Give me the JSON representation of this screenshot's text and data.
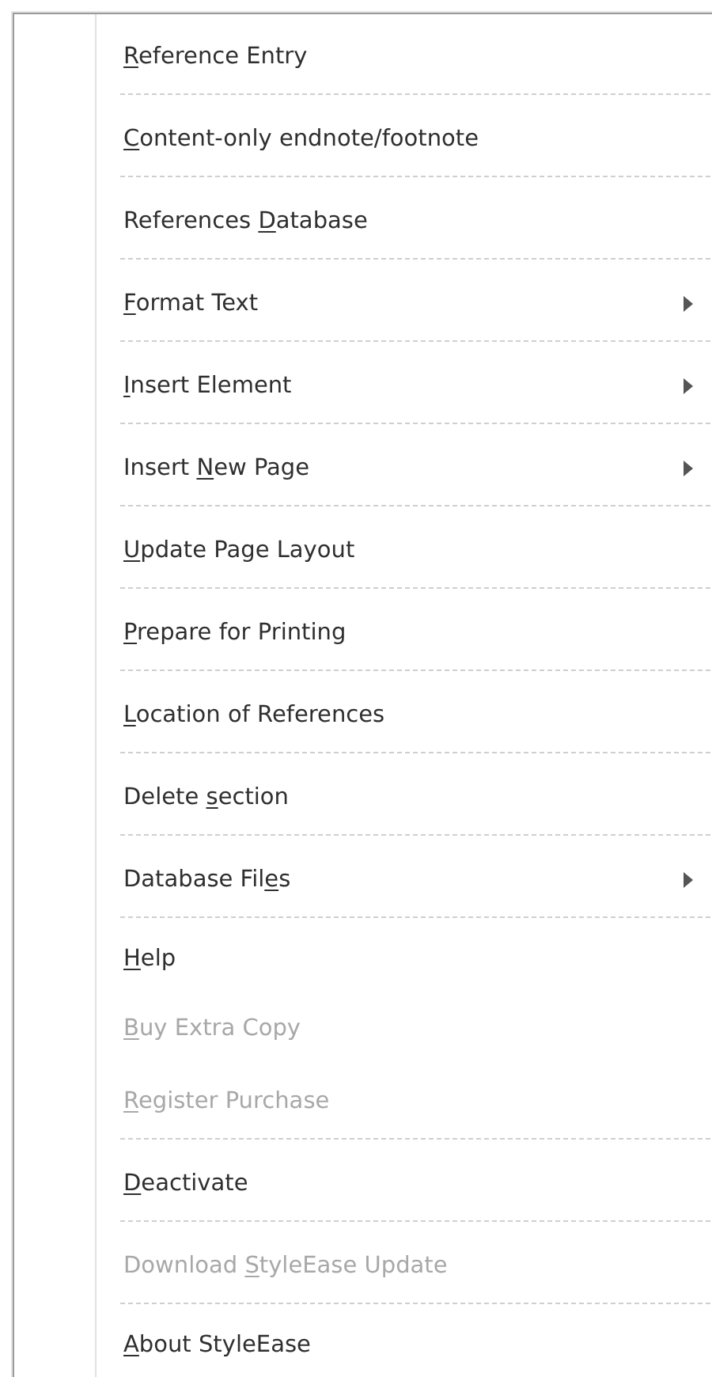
{
  "menu": {
    "items": [
      {
        "label": {
          "key": "R",
          "after": "eference Entry"
        },
        "disabled": false,
        "submenu": false,
        "separator": true
      },
      {
        "label": {
          "key": "C",
          "after": "ontent-only endnote/footnote"
        },
        "disabled": false,
        "submenu": false,
        "separator": true
      },
      {
        "label": {
          "before": "References ",
          "key": "D",
          "after": "atabase"
        },
        "disabled": false,
        "submenu": false,
        "separator": true
      },
      {
        "label": {
          "key": "F",
          "after": "ormat Text"
        },
        "disabled": false,
        "submenu": true,
        "separator": true
      },
      {
        "label": {
          "key": "I",
          "after": "nsert Element"
        },
        "disabled": false,
        "submenu": true,
        "separator": true
      },
      {
        "label": {
          "before": "Insert ",
          "key": "N",
          "after": "ew Page"
        },
        "disabled": false,
        "submenu": true,
        "separator": true
      },
      {
        "label": {
          "key": "U",
          "after": "pdate Page Layout"
        },
        "disabled": false,
        "submenu": false,
        "separator": true
      },
      {
        "label": {
          "key": "P",
          "after": "repare for Printing"
        },
        "disabled": false,
        "submenu": false,
        "separator": true
      },
      {
        "label": {
          "key": "L",
          "after": "ocation of References"
        },
        "disabled": false,
        "submenu": false,
        "separator": true
      },
      {
        "label": {
          "before": "Delete ",
          "key": "s",
          "after": "ection"
        },
        "disabled": false,
        "submenu": false,
        "separator": true
      },
      {
        "label": {
          "before": "Database Fil",
          "key": "e",
          "after": "s"
        },
        "disabled": false,
        "submenu": true,
        "separator": true
      },
      {
        "label": {
          "key": "H",
          "after": "elp"
        },
        "disabled": false,
        "submenu": false,
        "separator": false
      },
      {
        "label": {
          "key": "B",
          "after": "uy Extra Copy"
        },
        "disabled": true,
        "submenu": false,
        "separator": false
      },
      {
        "label": {
          "key": "R",
          "after": "egister Purchase"
        },
        "disabled": true,
        "submenu": false,
        "separator": true
      },
      {
        "label": {
          "key": "D",
          "after": "eactivate"
        },
        "disabled": false,
        "submenu": false,
        "separator": true
      },
      {
        "label": {
          "before": "Download ",
          "key": "S",
          "after": "tyleEase Update"
        },
        "disabled": true,
        "submenu": false,
        "separator": true
      },
      {
        "label": {
          "key": "A",
          "after": "bout StyleEase"
        },
        "disabled": false,
        "submenu": false,
        "separator": false
      }
    ]
  }
}
